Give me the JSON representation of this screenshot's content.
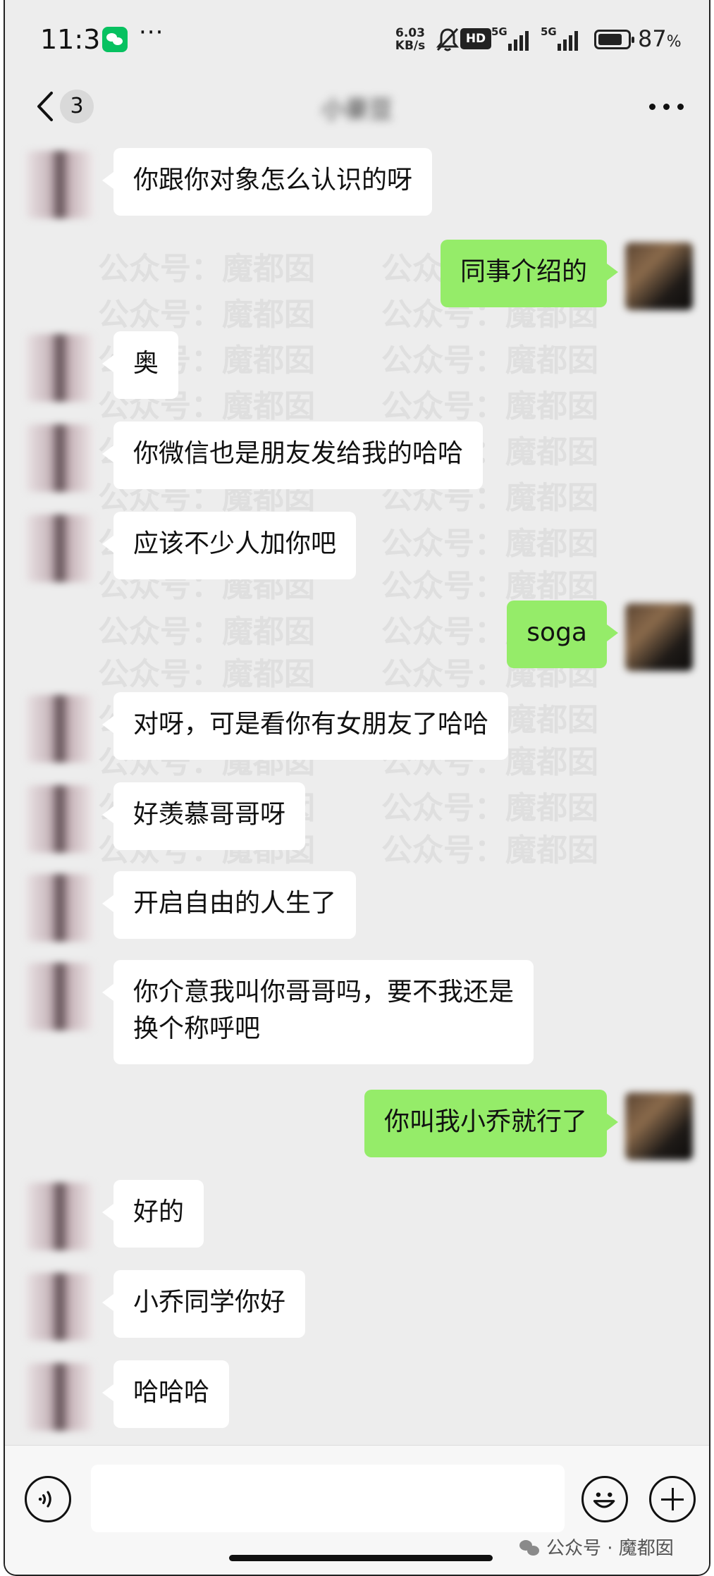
{
  "status_bar": {
    "time": "11:31",
    "more": "···",
    "net_speed_value": "6.03",
    "net_speed_unit": "KB/s",
    "hd_label": "HD",
    "signal1_label": "5G",
    "signal2_label": "5G",
    "battery_percent": "87",
    "battery_pct_unit": "%"
  },
  "nav": {
    "back_count": "3",
    "title": "小豪豆"
  },
  "messages": [
    {
      "side": "left",
      "text": "你跟你对象怎么认识的呀"
    },
    {
      "side": "right",
      "text": "同事介绍的"
    },
    {
      "side": "left",
      "text": "奥"
    },
    {
      "side": "left",
      "text": "你微信也是朋友发给我的哈哈"
    },
    {
      "side": "left",
      "text": "应该不少人加你吧"
    },
    {
      "side": "right",
      "text": "soga"
    },
    {
      "side": "left",
      "text": "对呀，可是看你有女朋友了哈哈"
    },
    {
      "side": "left",
      "text": "好羡慕哥哥呀"
    },
    {
      "side": "left",
      "text": "开启自由的人生了"
    },
    {
      "side": "left",
      "text": "你介意我叫你哥哥吗，要不我还是\n换个称呼吧"
    },
    {
      "side": "right",
      "text": "你叫我小乔就行了"
    },
    {
      "side": "left",
      "text": "好的"
    },
    {
      "side": "left",
      "text": "小乔同学你好"
    },
    {
      "side": "left",
      "text": "哈哈哈"
    }
  ],
  "watermark": {
    "text": "公众号：魔都囡"
  },
  "input": {
    "value": ""
  },
  "source_mark": "公众号 · 魔都囡",
  "colors": {
    "background": "#ededed",
    "bubble_self": "#95ec69",
    "bubble_other": "#ffffff",
    "wechat_green": "#07c160"
  },
  "icons": {
    "back": "chevron-left-icon",
    "more": "ellipsis-icon",
    "voice": "voice-icon",
    "emoji": "emoji-icon",
    "plus": "plus-icon"
  }
}
